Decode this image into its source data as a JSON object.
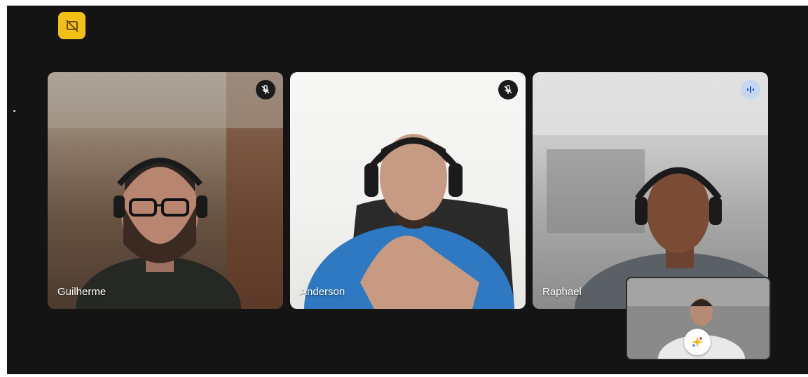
{
  "toolbar": {
    "present_icon": "presentation-off-icon",
    "present_color": "#f3c016"
  },
  "participants": [
    {
      "name": "Guilherme",
      "status": "muted",
      "status_icon": "mic-off-icon"
    },
    {
      "name": "Anderson",
      "status": "muted",
      "status_icon": "mic-off-icon"
    },
    {
      "name": "Raphael",
      "status": "speaking",
      "status_icon": "audio-wave-icon"
    }
  ],
  "self_view": {
    "effects_icon": "sparkle-effects-icon"
  }
}
